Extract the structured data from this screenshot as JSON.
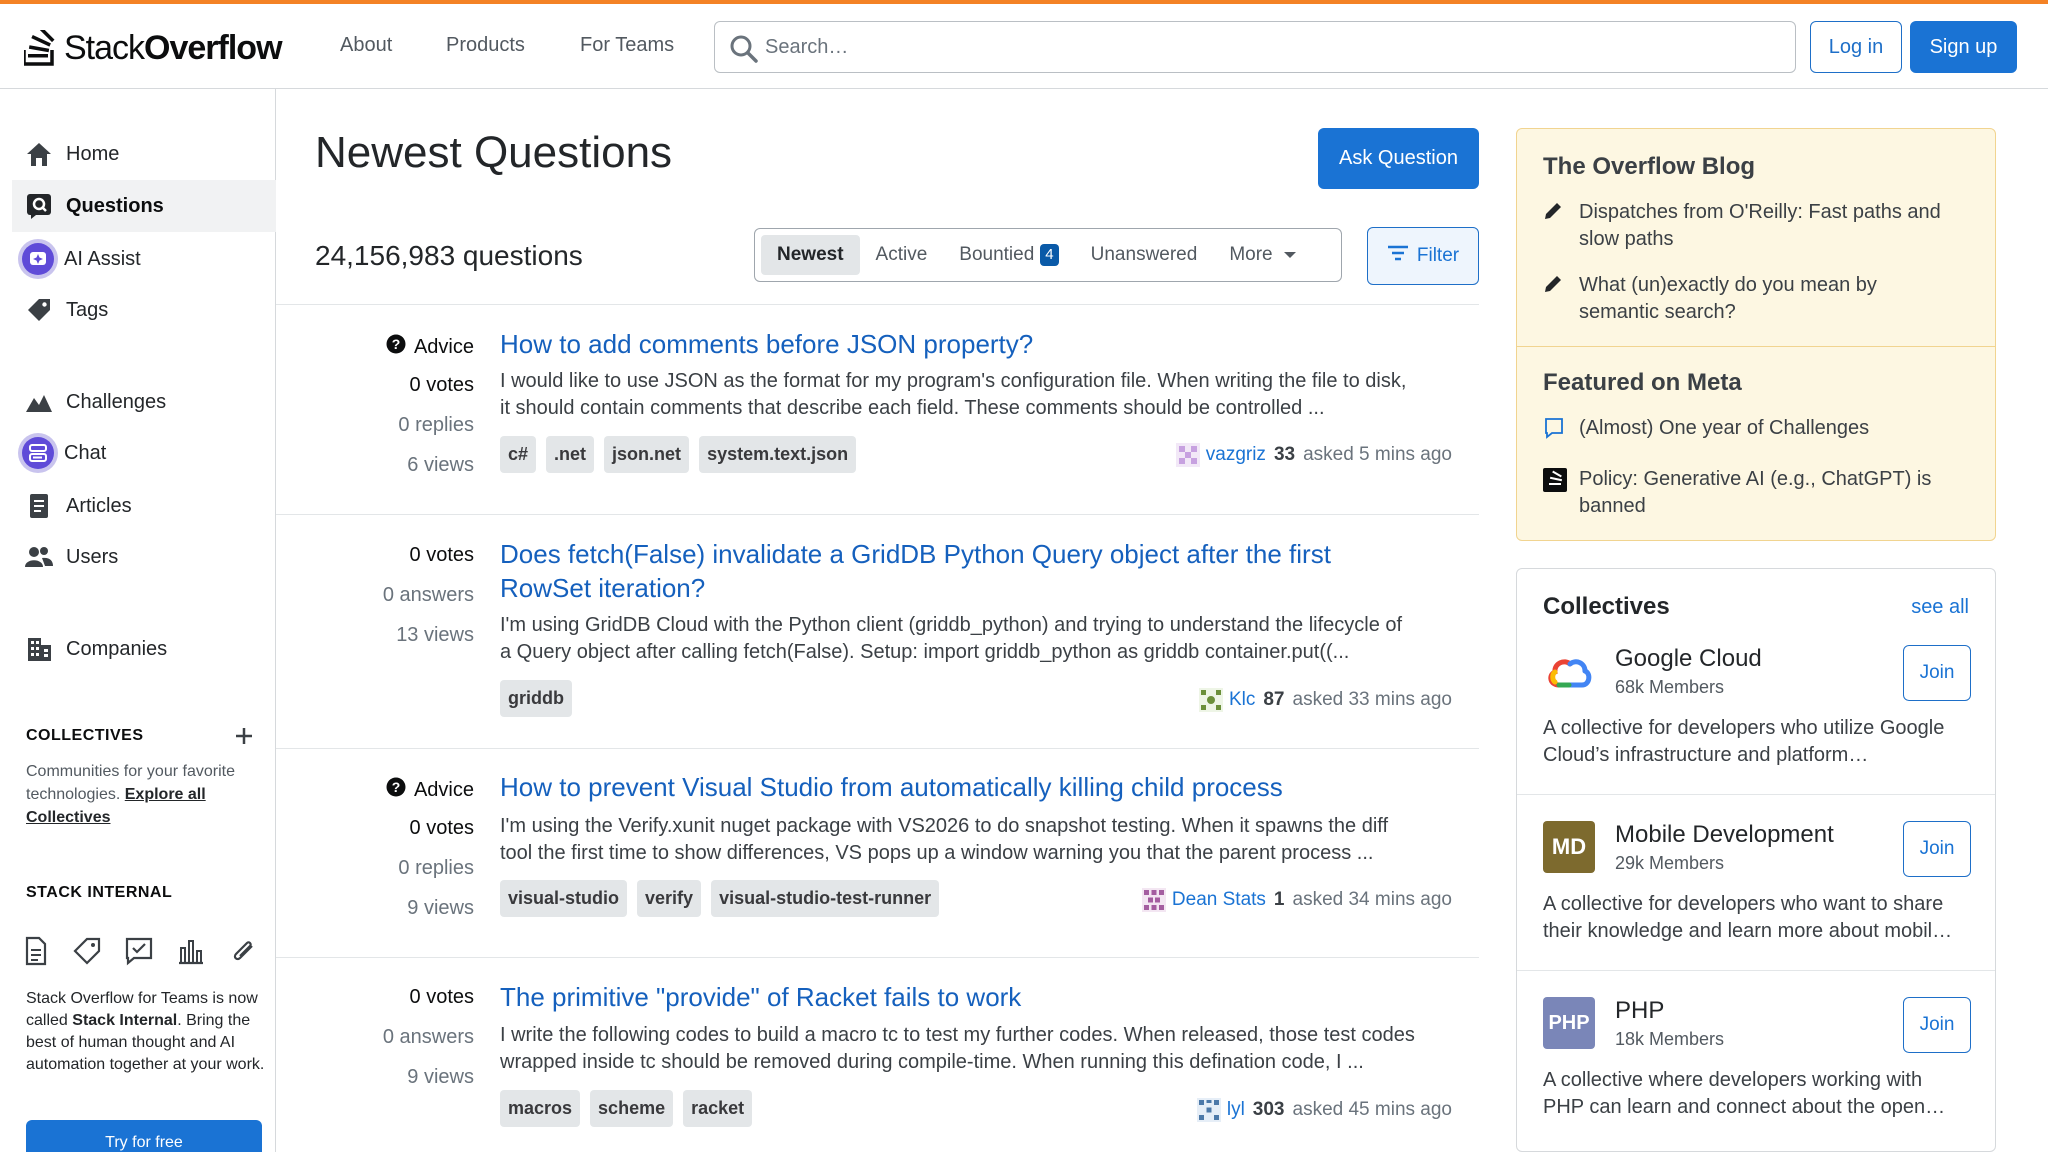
{
  "header": {
    "logo_text_regular": "Stack",
    "logo_text_bold": "Overflow",
    "nav": [
      "About",
      "Products",
      "For Teams"
    ],
    "search_placeholder": "Search…",
    "login_label": "Log in",
    "signup_label": "Sign up",
    "accent_color": "#f48225"
  },
  "sidebar": {
    "items": [
      {
        "label": "Home",
        "icon": "home-icon"
      },
      {
        "label": "Questions",
        "icon": "questions-icon",
        "active": true
      },
      {
        "label": "AI Assist",
        "icon": "ai-assist-icon"
      },
      {
        "label": "Tags",
        "icon": "tag-icon"
      },
      {
        "label": "Challenges",
        "icon": "challenges-icon"
      },
      {
        "label": "Chat",
        "icon": "chat-icon"
      },
      {
        "label": "Articles",
        "icon": "articles-icon"
      },
      {
        "label": "Users",
        "icon": "users-icon"
      },
      {
        "label": "Companies",
        "icon": "companies-icon"
      }
    ],
    "collectives_title": "COLLECTIVES",
    "collectives_desc": "Communities for your favorite technologies.",
    "collectives_link": "Explore all Collectives",
    "internal_title": "STACK INTERNAL",
    "internal_text_1": "Stack Overflow for Teams is now called",
    "internal_text_bold": "Stack Internal",
    "internal_text_2": ". Bring the best of human thought and AI automation together at your work.",
    "try_label": "Try for free"
  },
  "main": {
    "title": "Newest Questions",
    "ask_label": "Ask Question",
    "count": "24,156,983 questions",
    "tabs": [
      {
        "label": "Newest",
        "active": true
      },
      {
        "label": "Active"
      },
      {
        "label": "Bountied",
        "badge": "4"
      },
      {
        "label": "Unanswered"
      },
      {
        "label": "More"
      }
    ],
    "filter_label": "Filter",
    "questions": [
      {
        "advice": "Advice",
        "votes": "0 votes",
        "answers": "0 replies",
        "views": "6 views",
        "title": "How to add comments before JSON property?",
        "excerpt_1": "I would like to use JSON as the format for my program's configuration file. When writing the file to disk,",
        "excerpt_2": "it should contain comments that describe each field. These comments should be controlled ...",
        "tags": [
          "c#",
          ".net",
          "json.net",
          "system.text.json"
        ],
        "user": "vazgriz",
        "rep": "33",
        "time": "asked 5 mins ago"
      },
      {
        "votes": "0 votes",
        "answers": "0 answers",
        "views": "13 views",
        "title_1": "Does fetch(False) invalidate a GridDB Python Query object after the first",
        "title_2": "RowSet iteration?",
        "excerpt_1": "I'm using GridDB Cloud with the Python client (griddb_python) and trying to understand the lifecycle of",
        "excerpt_2": "a Query object after calling fetch(False). Setup: import griddb_python as griddb container.put((...",
        "tags": [
          "griddb"
        ],
        "user": "Klc",
        "rep": "87",
        "time": "asked 33 mins ago"
      },
      {
        "advice": "Advice",
        "votes": "0 votes",
        "answers": "0 replies",
        "views": "9 views",
        "title": "How to prevent Visual Studio from automatically killing child process",
        "excerpt_1": "I'm using the Verify.xunit nuget package with VS2026 to do snapshot testing. When it spawns the diff",
        "excerpt_2": "tool the first time to show differences, VS pops up a window warning you that the parent process ...",
        "tags": [
          "visual-studio",
          "verify",
          "visual-studio-test-runner"
        ],
        "user": "Dean Stats",
        "rep": "1",
        "time": "asked 34 mins ago"
      },
      {
        "votes": "0 votes",
        "answers": "0 answers",
        "views": "9 views",
        "title": "The primitive \"provide\" of Racket fails to work",
        "excerpt_1": "I write the following codes to build a macro tc to test my further codes. When released, those test codes",
        "excerpt_2": "wrapped inside tc should be removed during compile-time. When running this defination code, I ...",
        "tags": [
          "macros",
          "scheme",
          "racket"
        ],
        "user": "lyl",
        "rep": "303",
        "time": "asked 45 mins ago"
      }
    ]
  },
  "right": {
    "blog_title": "The Overflow Blog",
    "blog_items": [
      {
        "line1": "Dispatches from O'Reilly: Fast paths and",
        "line2": "slow paths"
      },
      {
        "line1": "What (un)exactly do you mean by",
        "line2": "semantic search?"
      }
    ],
    "meta_title": "Featured on Meta",
    "meta_items": [
      {
        "line1": "(Almost) One year of Challenges"
      },
      {
        "line1": "Policy: Generative AI (e.g., ChatGPT) is",
        "line2": "banned"
      }
    ],
    "collectives_title": "Collectives",
    "see_all": "see all",
    "collectives": [
      {
        "name": "Google Cloud",
        "members": "68k Members",
        "join": "Join",
        "desc_1": "A collective for developers who utilize Google",
        "desc_2": "Cloud’s infrastructure and platform…"
      },
      {
        "name": "Mobile Development",
        "logo": "MD",
        "members": "29k Members",
        "join": "Join",
        "desc_1": "A collective for developers who want to share",
        "desc_2": "their knowledge and learn more about mobil…"
      },
      {
        "name": "PHP",
        "logo": "PHP",
        "members": "18k Members",
        "join": "Join",
        "desc_1": "A collective where developers working with",
        "desc_2": "PHP can learn and connect about the open…"
      }
    ]
  }
}
